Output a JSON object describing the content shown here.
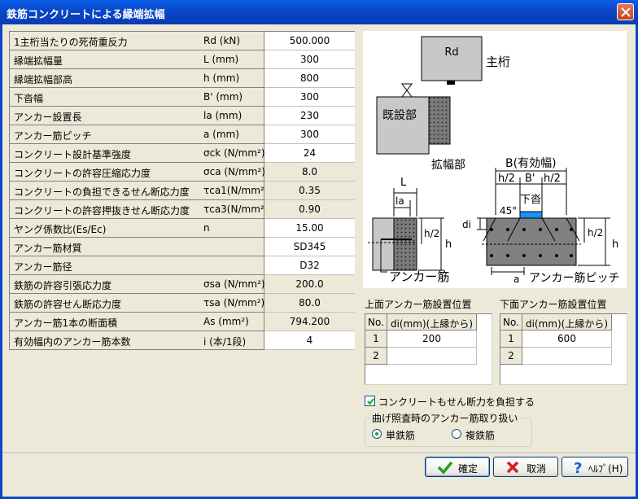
{
  "window": {
    "title": "鉄筋コンクリートによる縁端拡幅"
  },
  "params": [
    {
      "name": "1主桁当たりの死荷重反力",
      "sym": "Rd  (kN)",
      "value": "500.000",
      "editable": true
    },
    {
      "name": "縁端拡幅量",
      "sym": "L   (mm)",
      "value": "300",
      "editable": true
    },
    {
      "name": "縁端拡幅部高",
      "sym": "h   (mm)",
      "value": "800",
      "editable": true
    },
    {
      "name": "下沓幅",
      "sym": "B'  (mm)",
      "value": "300",
      "editable": true
    },
    {
      "name": "アンカー設置長",
      "sym": "la  (mm)",
      "value": "230",
      "editable": true
    },
    {
      "name": "アンカー筋ピッチ",
      "sym": "a   (mm)",
      "value": "300",
      "editable": true
    },
    {
      "name": "コンクリート設計基準強度",
      "sym": "σck (N/mm²)",
      "value": "24",
      "editable": true
    },
    {
      "name": "コンクリートの許容圧縮応力度",
      "sym": "σca (N/mm²)",
      "value": "8.0",
      "editable": false
    },
    {
      "name": "コンクリートの負担できるせん断応力度",
      "sym": "τca1(N/mm²)",
      "value": "0.35",
      "editable": false
    },
    {
      "name": "コンクリートの許容押抜きせん断応力度",
      "sym": "τca3(N/mm²)",
      "value": "0.90",
      "editable": false
    },
    {
      "name": "ヤング係数比(Es/Ec)",
      "sym": "n",
      "value": "15.00",
      "editable": true
    },
    {
      "name": "アンカー筋材質",
      "sym": "",
      "value": "SD345",
      "editable": true
    },
    {
      "name": "アンカー筋径",
      "sym": "",
      "value": "D32",
      "editable": true
    },
    {
      "name": "鉄筋の許容引張応力度",
      "sym": "σsa (N/mm²)",
      "value": "200.0",
      "editable": false
    },
    {
      "name": "鉄筋の許容せん断応力度",
      "sym": "τsa (N/mm²)",
      "value": "80.0",
      "editable": false
    },
    {
      "name": "アンカー筋1本の断面積",
      "sym": "As  (mm²)",
      "value": "794.200",
      "editable": false
    },
    {
      "name": "有効幅内のアンカー筋本数",
      "sym": "i   (本/1段)",
      "value": "4",
      "editable": true
    }
  ],
  "diagram": {
    "rd": "Rd",
    "main_girder": "主桁",
    "existing": "既設部",
    "widening": "拡幅部",
    "b_eff": "B(有効幅)",
    "h2": "h/2",
    "bprime": "B'",
    "lower_shoe": "下沓",
    "deg45": "45°",
    "L": "L",
    "la": "la",
    "h": "h",
    "di": "di",
    "a": "a",
    "anchor": "アンカー筋",
    "anchor_pitch": "アンカー筋ピッチ"
  },
  "top_anchor": {
    "label": "上面アンカー筋設置位置",
    "col_no": "No.",
    "col_di": "di(mm)(上縁から)",
    "rows": [
      {
        "no": "1",
        "di": "200"
      },
      {
        "no": "2",
        "di": ""
      }
    ]
  },
  "bottom_anchor": {
    "label": "下面アンカー筋設置位置",
    "col_no": "No.",
    "col_di": "di(mm)(上縁から)",
    "rows": [
      {
        "no": "1",
        "di": "600"
      },
      {
        "no": "2",
        "di": ""
      }
    ]
  },
  "shear_check": {
    "label": "コンクリートもせん断力を負担する",
    "checked": true
  },
  "bending": {
    "legend": "曲げ照査時のアンカー筋取り扱い",
    "single": "単鉄筋",
    "double": "複鉄筋",
    "selected": "single"
  },
  "buttons": {
    "ok": "確定",
    "cancel": "取消",
    "help": "ﾍﾙﾌﾟ(H)"
  },
  "colors": {
    "title_bar": "#0a4fd8",
    "face": "#ece9d8",
    "shoe": "#1e90ff"
  }
}
